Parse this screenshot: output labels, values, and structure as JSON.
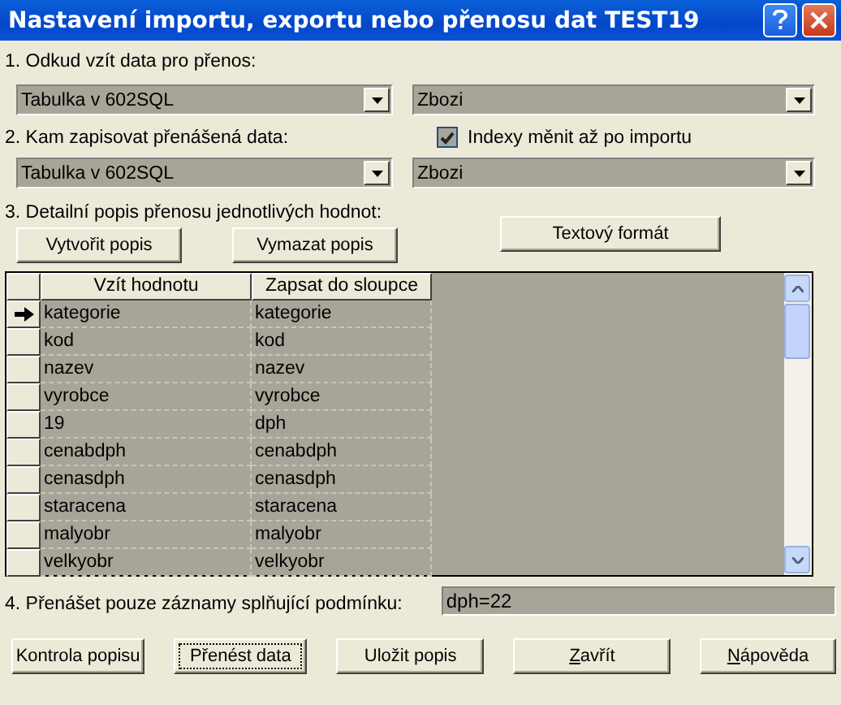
{
  "window": {
    "title": "Nastavení importu, exportu nebo přenosu dat TEST19"
  },
  "source": {
    "label": "1. Odkud vzít data pro přenos:",
    "type": "Tabulka v 602SQL",
    "table": "Zbozi"
  },
  "target": {
    "label": "2. Kam zapisovat přenášená data:",
    "type": "Tabulka v 602SQL",
    "table": "Zbozi"
  },
  "index_option": {
    "label": "Indexy měnit až po importu",
    "checked": true
  },
  "detail": {
    "label": "3. Detailní popis přenosu jednotlivých hodnot:",
    "buttons": [
      "Vytvořit popis",
      "Vymazat popis",
      "Textový formát"
    ],
    "columns": [
      "Vzít hodnotu",
      "Zapsat do sloupce"
    ],
    "rows": [
      {
        "from": "kategorie",
        "to": "kategorie",
        "selected": true
      },
      {
        "from": "kod",
        "to": "kod",
        "selected": false
      },
      {
        "from": "nazev",
        "to": "nazev",
        "selected": false
      },
      {
        "from": "vyrobce",
        "to": "vyrobce",
        "selected": false
      },
      {
        "from": "19",
        "to": "dph",
        "selected": false
      },
      {
        "from": "cenabdph",
        "to": "cenabdph",
        "selected": false
      },
      {
        "from": "cenasdph",
        "to": "cenasdph",
        "selected": false
      },
      {
        "from": "staracena",
        "to": "staracena",
        "selected": false
      },
      {
        "from": "malyobr",
        "to": "malyobr",
        "selected": false
      },
      {
        "from": "velkyobr",
        "to": "velkyobr",
        "selected": false
      }
    ]
  },
  "condition": {
    "label": "4. Přenášet pouze záznamy splňující podmínku:",
    "value": "dph=22"
  },
  "buttons": [
    {
      "label": "Kontrola popisu",
      "focused": false,
      "mnemonic": false
    },
    {
      "label": "Přenést data",
      "focused": true,
      "mnemonic": false
    },
    {
      "label": "Uložit popis",
      "focused": false,
      "mnemonic": false
    },
    {
      "label": "Zavřít",
      "focused": false,
      "mnemonic": true
    },
    {
      "label": "Nápověda",
      "focused": false,
      "mnemonic": true
    }
  ]
}
